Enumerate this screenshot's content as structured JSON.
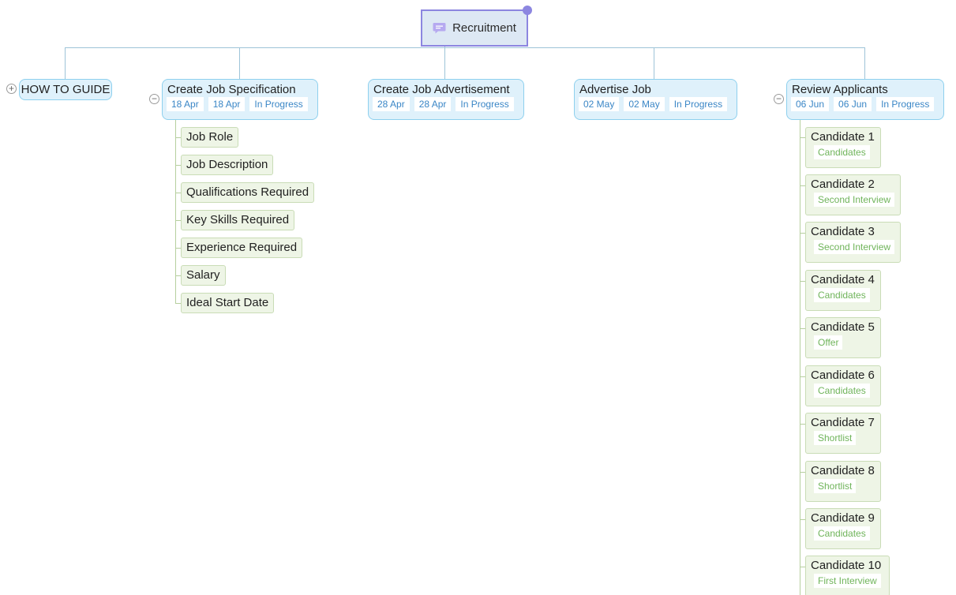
{
  "root": {
    "label": "Recruitment",
    "icon": "comment-icon",
    "accent": "#8c86e0"
  },
  "guide": {
    "label": "HOW TO GUIDE",
    "toggle": "+"
  },
  "topics": [
    {
      "title": "Create Job Specification",
      "tags": [
        "18 Apr",
        "18 Apr",
        "In Progress"
      ],
      "toggle": "−"
    },
    {
      "title": "Create Job Advertisement",
      "tags": [
        "28 Apr",
        "28 Apr",
        "In Progress"
      ]
    },
    {
      "title": "Advertise Job",
      "tags": [
        "02 May",
        "02 May",
        "In Progress"
      ]
    },
    {
      "title": "Review Applicants",
      "tags": [
        "06 Jun",
        "06 Jun",
        "In Progress"
      ],
      "toggle": "−"
    }
  ],
  "job_spec_items": [
    "Job Role",
    "Job Description",
    "Qualifications Required",
    "Key Skills Required",
    "Experience Required",
    "Salary",
    "Ideal Start Date"
  ],
  "candidates": [
    {
      "name": "Candidate 1",
      "stage": "Candidates"
    },
    {
      "name": "Candidate 2",
      "stage": "Second Interview"
    },
    {
      "name": "Candidate 3",
      "stage": "Second Interview"
    },
    {
      "name": "Candidate 4",
      "stage": "Candidates"
    },
    {
      "name": "Candidate 5",
      "stage": "Offer"
    },
    {
      "name": "Candidate 6",
      "stage": "Candidates"
    },
    {
      "name": "Candidate 7",
      "stage": "Shortlist"
    },
    {
      "name": "Candidate 8",
      "stage": "Shortlist"
    },
    {
      "name": "Candidate 9",
      "stage": "Candidates"
    },
    {
      "name": "Candidate 10",
      "stage": "First Interview"
    }
  ],
  "colors": {
    "topic_border": "#8ed0ee",
    "topic_fill": "#dff1fb",
    "date_tag_text": "#3a86c6",
    "sub_fill": "#eef5e6",
    "stage_tag_text": "#6fb45a",
    "connector": "#9ec4d8"
  }
}
